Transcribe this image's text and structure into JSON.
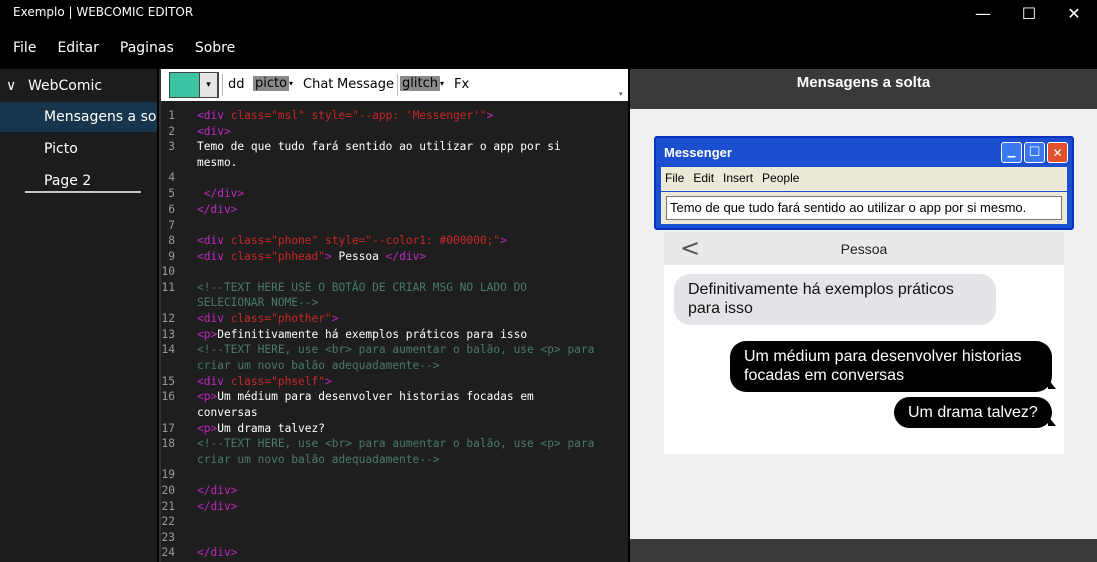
{
  "window": {
    "title": "Exemplo | WEBCOMIC EDITOR",
    "minimize_glyph": "—",
    "maximize_glyph": "☐",
    "close_glyph": "✕"
  },
  "menubar": [
    "File",
    "Editar",
    "Paginas",
    "Sobre"
  ],
  "tree": {
    "root": "WebComic",
    "root_chevron": "∨",
    "items": [
      "Mensagens a solta",
      "Picto",
      "Page 2"
    ],
    "selected_index": 0
  },
  "toolbar": {
    "color": "#3cc3a2",
    "dropdown_glyph": "▾",
    "buttons": {
      "dd": "dd",
      "picto": "picto",
      "chat": "Chat",
      "message": "Message",
      "glitch": "glitch",
      "fx": "Fx"
    },
    "arrow": "▾",
    "corner": "▾"
  },
  "code": {
    "line_numbers": [
      "1",
      "2",
      "3",
      "",
      "4",
      "5",
      "6",
      "7",
      "8",
      "9",
      "10",
      "11",
      "",
      "12",
      "13",
      "14",
      "",
      "15",
      "16",
      "",
      "17",
      "18",
      "",
      "19",
      "20",
      "21",
      "22",
      "23",
      "24"
    ],
    "lines": {
      "l1": {
        "tag_open": "<div ",
        "attr1": "class=",
        "val1": "\"msl\" ",
        "attr2": "style=",
        "val2": "\"--app: 'Messenger'\"",
        "tag_close": ">"
      },
      "l2": "<div>",
      "l3a": "Temo de que tudo fará sentido ao utilizar o app por si",
      "l3b": "mesmo.",
      "l5": " </div>",
      "l6": "</div>",
      "l8": {
        "tag_open": "<div ",
        "attr1": "class=",
        "val1": "\"phone\" ",
        "attr2": "style=",
        "val2": "\"--color1: #000000;\"",
        "tag_close": ">"
      },
      "l9": {
        "tag_open": "<div ",
        "attr1": "class=",
        "val1": "\"phhead\"",
        "tag_close": ">",
        "text": " Pessoa ",
        "end": "</div>"
      },
      "l11a": "<!--TEXT HERE USE O BOTÃO DE CRIAR MSG NO LADO DO",
      "l11b": "SELECIONAR NOME-->",
      "l12": {
        "tag_open": "<div ",
        "attr1": "class=",
        "val1": "\"phother\"",
        "tag_close": ">"
      },
      "l13": {
        "tag": "<p>",
        "text": "Definitivamente há exemplos práticos para isso"
      },
      "l14a": "<!--TEXT HERE, use <br> para aumentar o balão, use <p> para",
      "l14b": "criar um novo balão adequadamente-->",
      "l15": {
        "tag_open": "<div ",
        "attr1": "class=",
        "val1": "\"phself\"",
        "tag_close": ">"
      },
      "l16a": {
        "tag": "<p>",
        "text": "Um médium para desenvolver historias focadas em"
      },
      "l16b": "conversas",
      "l17": {
        "tag": "<p>",
        "text": "Um drama talvez?"
      },
      "l18a": "<!--TEXT HERE, use <br> para aumentar o balão, use <p> para",
      "l18b": "criar um novo balão adequadamente-->",
      "l20": "</div>",
      "l21": "</div>",
      "l24": "</div>"
    }
  },
  "preview": {
    "title": "Mensagens a solta",
    "messenger": {
      "title": "Messenger",
      "menu": [
        "File",
        "Edit",
        "Insert",
        "People"
      ],
      "status_text": "Temo de que tudo fará sentido ao utilizar o app por si mesmo.",
      "btn_min": "▁",
      "btn_max": "☐",
      "btn_close": "✕"
    },
    "phone": {
      "back_glyph": "<",
      "contact": "Pessoa",
      "incoming": [
        "Definitivamente há exemplos práticos",
        "para isso"
      ],
      "outgoing": [
        [
          "Um médium para desenvolver historias",
          "focadas em conversas"
        ],
        [
          "Um drama talvez?"
        ]
      ]
    }
  }
}
